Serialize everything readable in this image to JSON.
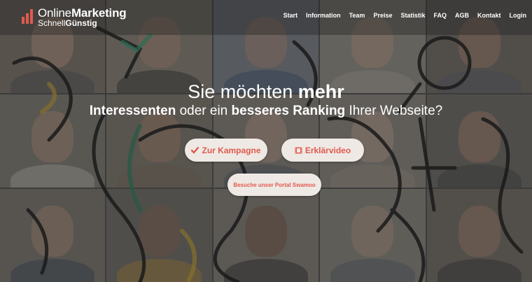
{
  "logo": {
    "line1_normal": "Online",
    "line1_bold": "Marketing",
    "line2_normal": "Schnell",
    "line2_bold": "Günstig",
    "icon": "bar-chart-icon",
    "accent": "#e05a4e"
  },
  "nav": {
    "items": [
      "Start",
      "Information",
      "Team",
      "Preise",
      "Statistik",
      "FAQ",
      "AGB",
      "Kontakt",
      "Login"
    ]
  },
  "hero": {
    "headline_normal": "Sie möchten ",
    "headline_bold": "mehr",
    "sub_bold1": "Interessenten",
    "sub_normal1": " oder ein ",
    "sub_bold2": "besseres Ranking",
    "sub_normal2": " Ihrer Webseite?",
    "btn_kampagne": "Zur Kampagne",
    "btn_kampagne_icon": "check-icon",
    "btn_video": "Erklärvideo",
    "btn_video_icon": "film-icon",
    "btn_portal": "Besuche unser Portal Swamoo",
    "button_bg": "#efe9e5",
    "button_text": "#e05a4e"
  }
}
